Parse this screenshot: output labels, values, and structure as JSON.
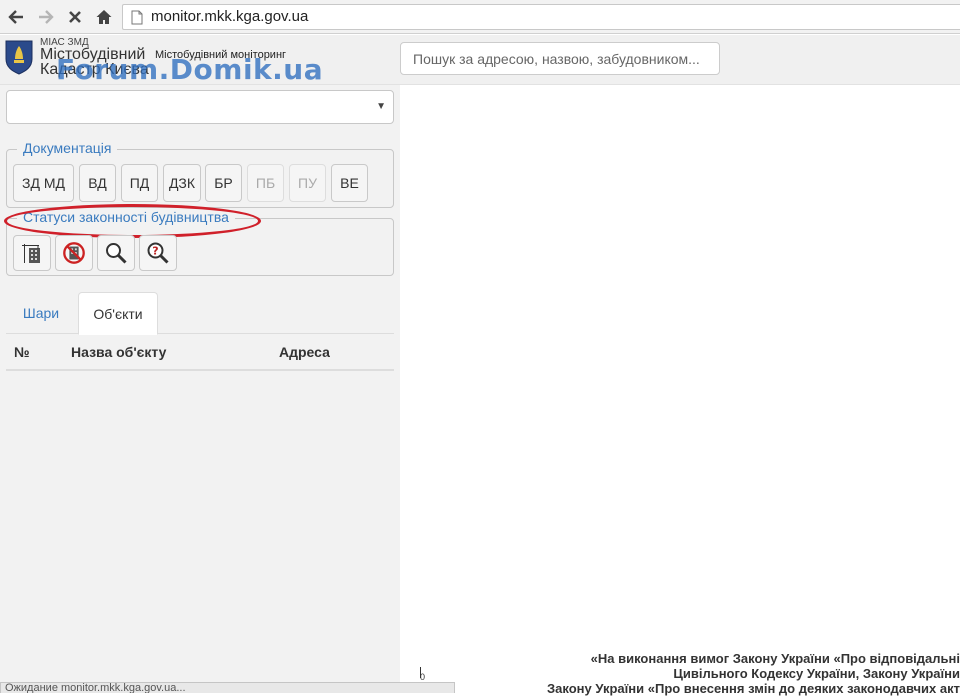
{
  "browser": {
    "url": "monitor.mkk.kga.gov.ua",
    "back_icon": "arrow-left-icon",
    "forward_icon": "arrow-right-icon",
    "stop_icon": "close-icon",
    "home_icon": "home-icon"
  },
  "header": {
    "org_short": "МІАС ЗМД",
    "brand_line1": "Містобудівний",
    "brand_line2": "Кадастр Києва",
    "subtitle": "Містобудівний моніторинг",
    "watermark": "Forum.Domik.ua",
    "search_placeholder": "Пошук за адресою, назвою, забудовником..."
  },
  "sidebar": {
    "layer_select_value": "",
    "dots": [
      "#5b9bd5",
      "#dede70",
      "#d87a8e"
    ],
    "documentation": {
      "legend": "Документація",
      "buttons": [
        {
          "label": "ЗД МД",
          "enabled": true
        },
        {
          "label": "ВД",
          "enabled": true
        },
        {
          "label": "ПД",
          "enabled": true
        },
        {
          "label": "ДЗК",
          "enabled": true
        },
        {
          "label": "БР",
          "enabled": true
        },
        {
          "label": "ПБ",
          "enabled": false
        },
        {
          "label": "ПУ",
          "enabled": false
        },
        {
          "label": "ВЕ",
          "enabled": true
        }
      ]
    },
    "statuses": {
      "legend": "Статуси законності будівництва",
      "icons": [
        "building-crane-icon",
        "no-building-icon",
        "magnifier-icon",
        "question-magnifier-icon"
      ]
    },
    "tabs": [
      {
        "label": "Шари",
        "active": false
      },
      {
        "label": "Об'єкти",
        "active": true
      }
    ],
    "table": {
      "columns": [
        "№",
        "Назва об'єкту",
        "Адреса"
      ],
      "rows": []
    }
  },
  "map": {
    "legal_lines": [
      "«На виконання вимог Закону України «Про відповідальні",
      "Цивільного Кодексу України, Закону України",
      "Закону України «Про внесення змін до деяких законодавчих акт"
    ],
    "scale_zero": "0"
  },
  "status_bar": "Ожидание monitor.mkk.kga.gov.ua..."
}
